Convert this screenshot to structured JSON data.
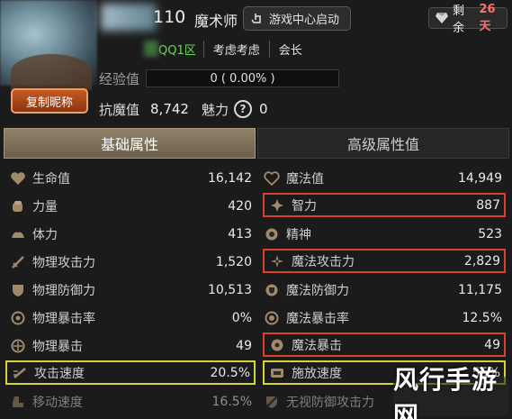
{
  "header": {
    "level": "110",
    "class_name": "魔术师",
    "launch_button": "游戏中心启动",
    "days_label": "剩余",
    "days_value": "26天",
    "server": "QQ1区",
    "guild": "考虑考虑",
    "role": "会长",
    "exp_label": "经验值",
    "exp_value": "0 ( 0.00% )",
    "copy_button": "复制昵称",
    "resist_label": "抗魔值",
    "resist_value": "8,742",
    "charm_label": "魅力",
    "charm_value": "0",
    "help_glyph": "?"
  },
  "tabs": [
    {
      "label": "基础属性",
      "active": true
    },
    {
      "label": "高级属性值",
      "active": false
    }
  ],
  "stats": {
    "left": [
      {
        "icon": "heart-icon",
        "label": "生命值",
        "value": "16,142"
      },
      {
        "icon": "fist-icon",
        "label": "力量",
        "value": "420"
      },
      {
        "icon": "stamina-icon",
        "label": "体力",
        "value": "413"
      },
      {
        "icon": "sword-icon",
        "label": "物理攻击力",
        "value": "1,520"
      },
      {
        "icon": "shield-icon",
        "label": "物理防御力",
        "value": "10,513"
      },
      {
        "icon": "target-icon",
        "label": "物理暴击率",
        "value": "0%"
      },
      {
        "icon": "crit-icon",
        "label": "物理暴击",
        "value": "49"
      },
      {
        "icon": "speed-icon",
        "label": "攻击速度",
        "value": "20.5%"
      },
      {
        "icon": "boot-icon",
        "label": "移动速度",
        "value": "16.5%"
      }
    ],
    "right": [
      {
        "icon": "mana-heart-icon",
        "label": "魔法值",
        "value": "14,949"
      },
      {
        "icon": "intellect-icon",
        "label": "智力",
        "value": "887"
      },
      {
        "icon": "spirit-icon",
        "label": "精神",
        "value": "523"
      },
      {
        "icon": "magic-attack-icon",
        "label": "魔法攻击力",
        "value": "2,829"
      },
      {
        "icon": "magic-shield-icon",
        "label": "魔法防御力",
        "value": "11,175"
      },
      {
        "icon": "magic-target-icon",
        "label": "魔法暴击率",
        "value": "12.5%"
      },
      {
        "icon": "magic-crit-icon",
        "label": "魔法暴击",
        "value": "49"
      },
      {
        "icon": "cast-speed-icon",
        "label": "施放速度",
        "value": "55%"
      },
      {
        "icon": "ignore-def-icon",
        "label": "无视防御攻击力",
        "value": ""
      }
    ]
  },
  "watermark": "风行手游网",
  "colors": {
    "highlight_red": "#d9402e",
    "highlight_yellow": "#d6d23a",
    "server_green": "#6cd45a",
    "days_red": "#ff6f6f"
  }
}
